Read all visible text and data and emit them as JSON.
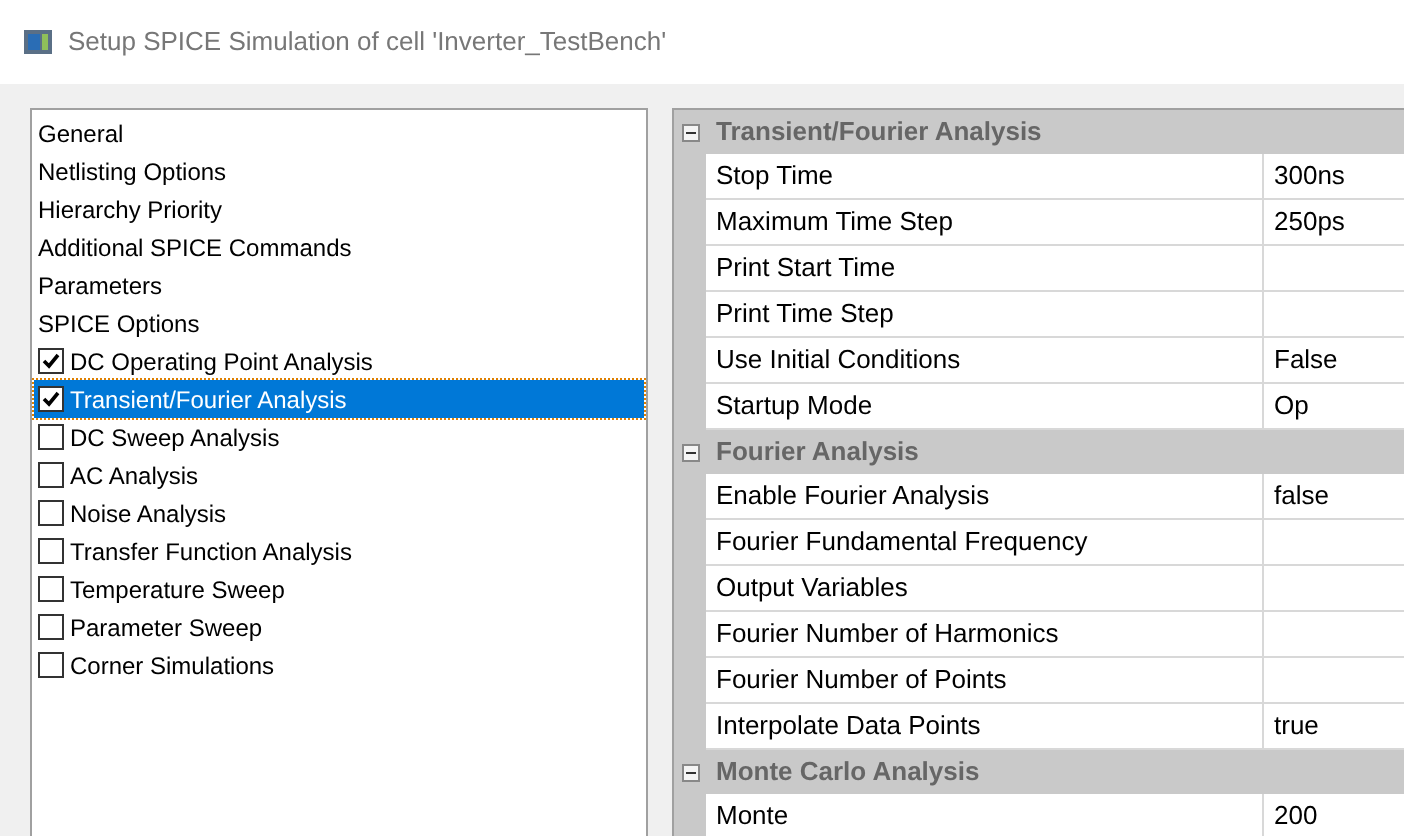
{
  "window": {
    "title": "Setup SPICE Simulation of cell 'Inverter_TestBench'"
  },
  "sidebar": {
    "items": [
      {
        "label": "General",
        "kind": "plain",
        "selected": false
      },
      {
        "label": "Netlisting Options",
        "kind": "plain",
        "selected": false
      },
      {
        "label": "Hierarchy Priority",
        "kind": "plain",
        "selected": false
      },
      {
        "label": "Additional SPICE Commands",
        "kind": "plain",
        "selected": false
      },
      {
        "label": "Parameters",
        "kind": "plain",
        "selected": false
      },
      {
        "label": "SPICE Options",
        "kind": "plain",
        "selected": false
      },
      {
        "label": "DC Operating Point Analysis",
        "kind": "checkbox",
        "checked": true,
        "selected": false
      },
      {
        "label": "Transient/Fourier Analysis",
        "kind": "checkbox",
        "checked": true,
        "selected": true
      },
      {
        "label": "DC Sweep Analysis",
        "kind": "checkbox",
        "checked": false,
        "selected": false
      },
      {
        "label": "AC Analysis",
        "kind": "checkbox",
        "checked": false,
        "selected": false
      },
      {
        "label": "Noise Analysis",
        "kind": "checkbox",
        "checked": false,
        "selected": false
      },
      {
        "label": "Transfer Function Analysis",
        "kind": "checkbox",
        "checked": false,
        "selected": false
      },
      {
        "label": "Temperature Sweep",
        "kind": "checkbox",
        "checked": false,
        "selected": false
      },
      {
        "label": "Parameter Sweep",
        "kind": "checkbox",
        "checked": false,
        "selected": false
      },
      {
        "label": "Corner Simulations",
        "kind": "checkbox",
        "checked": false,
        "selected": false
      }
    ]
  },
  "property_grid": {
    "sections": [
      {
        "title": "Transient/Fourier Analysis",
        "expanded": true,
        "rows": [
          {
            "name": "Stop Time",
            "value": "300ns"
          },
          {
            "name": "Maximum Time Step",
            "value": "250ps"
          },
          {
            "name": "Print Start Time"
          },
          {
            "name": "Print Time Step"
          },
          {
            "name": "Use Initial Conditions",
            "value": "False"
          },
          {
            "name": "Startup Mode",
            "value": "Op"
          }
        ]
      },
      {
        "title": "Fourier Analysis",
        "expanded": true,
        "rows": [
          {
            "name": "Enable Fourier Analysis",
            "value": "false"
          },
          {
            "name": "Fourier Fundamental Frequency"
          },
          {
            "name": "Output Variables"
          },
          {
            "name": "Fourier Number of Harmonics"
          },
          {
            "name": "Fourier Number of Points"
          },
          {
            "name": "Interpolate Data Points",
            "value": "true"
          }
        ]
      },
      {
        "title": "Monte Carlo Analysis",
        "expanded": true,
        "rows": [
          {
            "name": "Monte",
            "value": "200"
          }
        ]
      }
    ]
  }
}
